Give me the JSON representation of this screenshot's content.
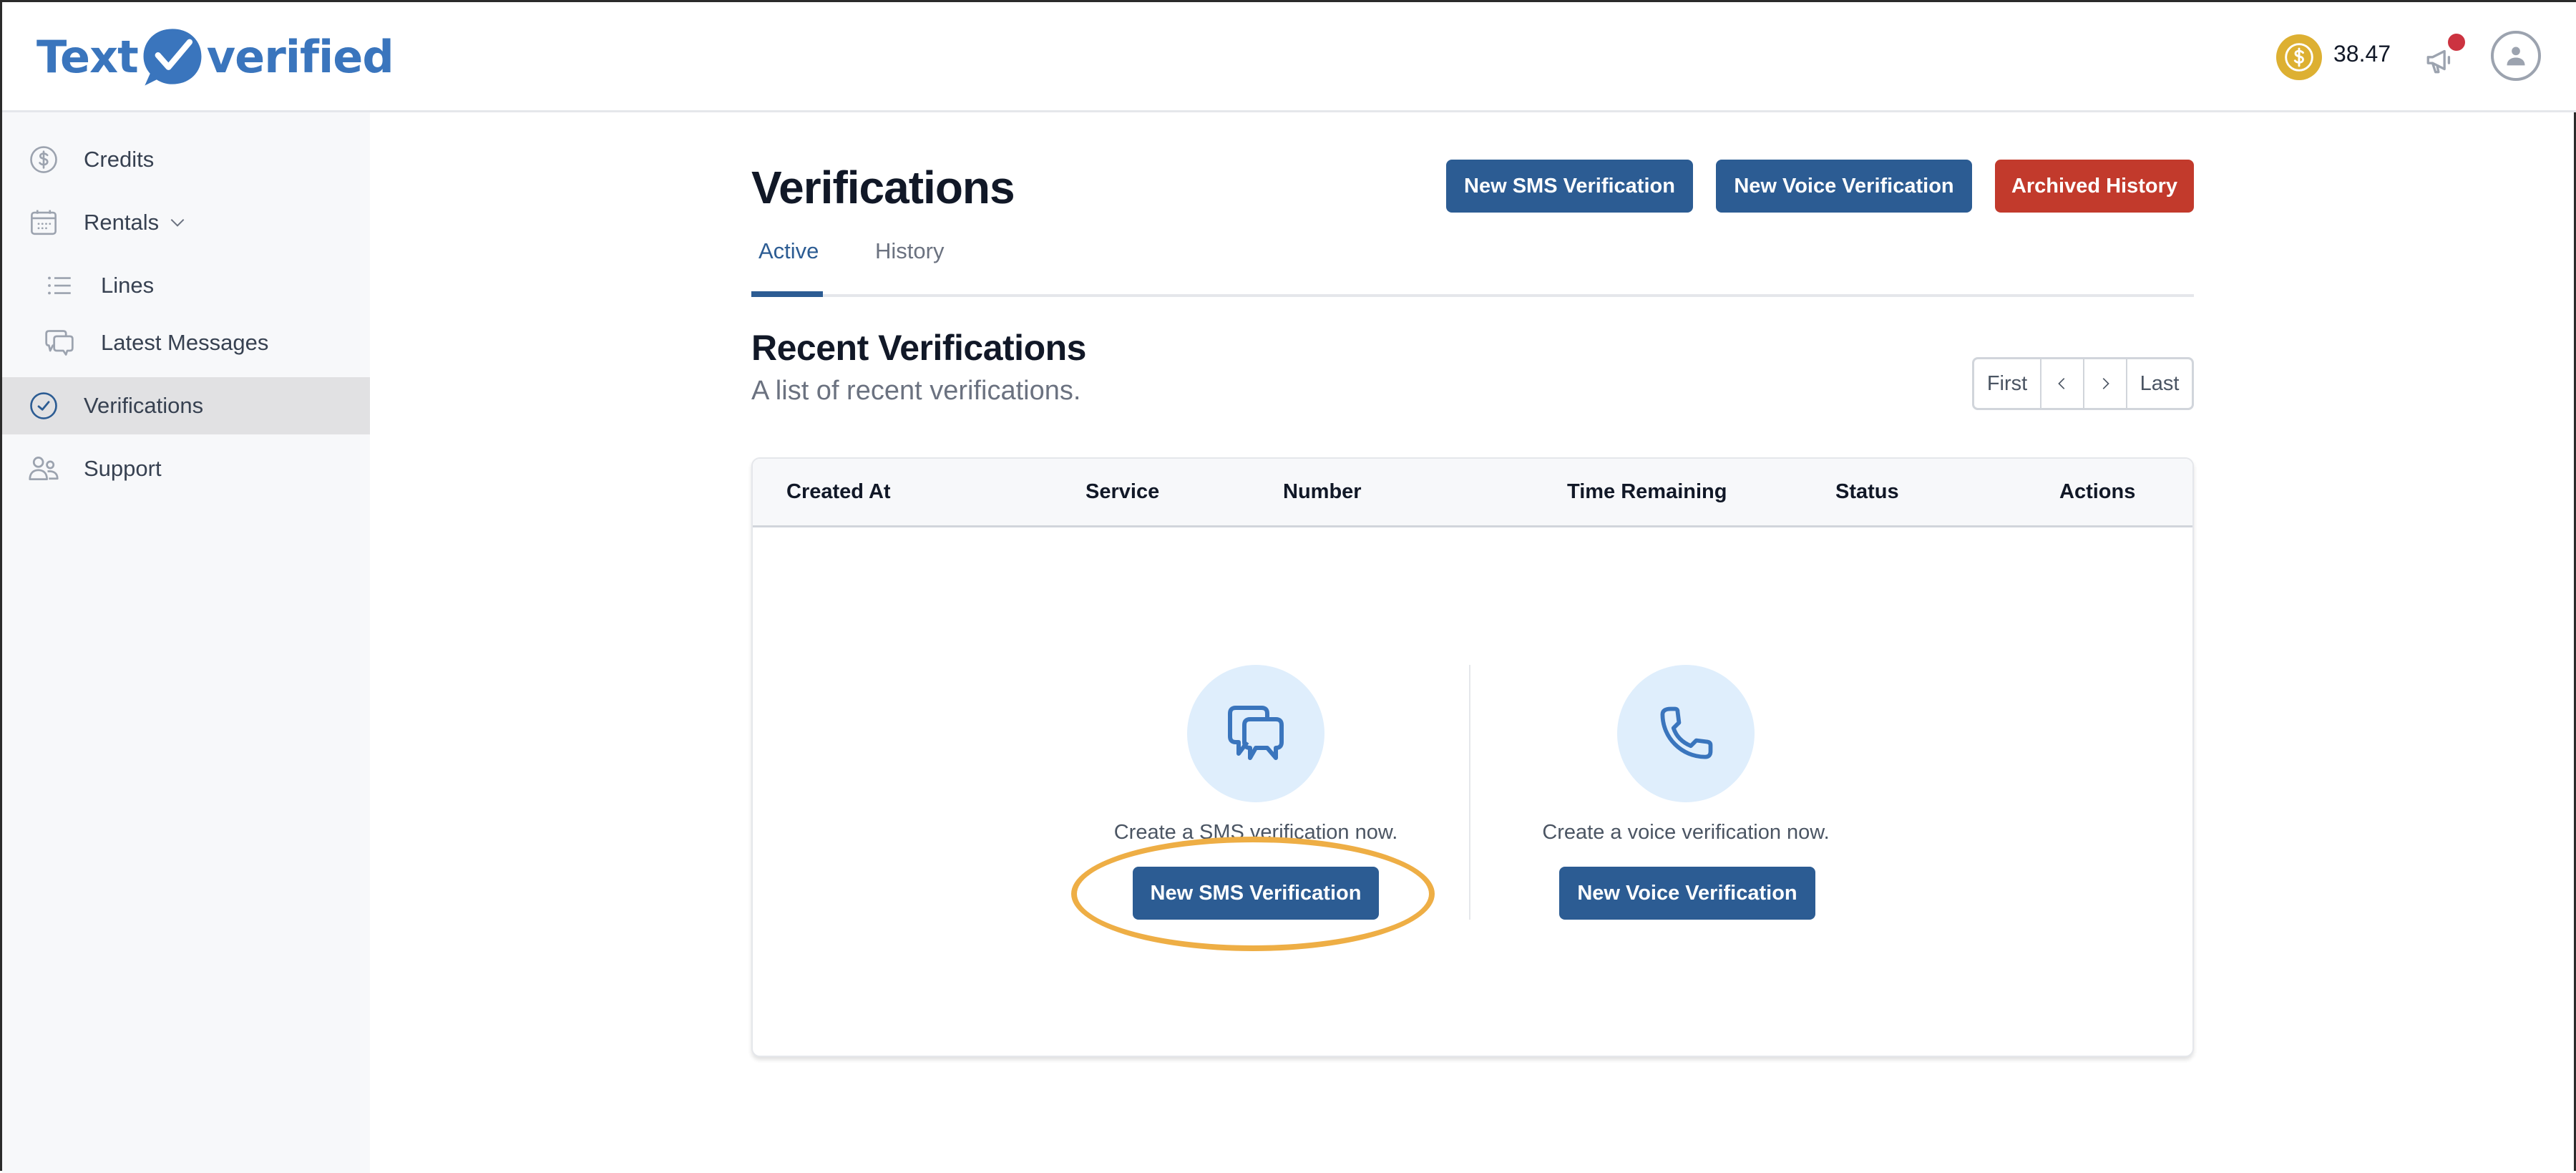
{
  "header": {
    "logo": {
      "left_text": "Text",
      "right_text": "verified",
      "icon": "chat-check-bubble-icon"
    },
    "credits": {
      "icon": "dollar-coin-icon",
      "amount": "38.47"
    },
    "announcements": {
      "icon": "megaphone-icon",
      "has_unread": true
    },
    "account": {
      "icon": "user-avatar-icon"
    }
  },
  "sidebar": {
    "items": [
      {
        "label": "Credits",
        "icon": "dollar-circle-icon"
      },
      {
        "label": "Rentals",
        "icon": "calendar-icon",
        "expanded": true
      },
      {
        "label": "Lines",
        "icon": "list-icon"
      },
      {
        "label": "Latest Messages",
        "icon": "chat-bubbles-icon"
      },
      {
        "label": "Verifications",
        "icon": "check-circle-icon",
        "active": true
      },
      {
        "label": "Support",
        "icon": "users-icon"
      }
    ]
  },
  "main": {
    "title": "Verifications",
    "actions": {
      "new_sms": "New SMS Verification",
      "new_voice": "New Voice Verification",
      "archived": "Archived History"
    },
    "tabs": [
      {
        "label": "Active",
        "active": true
      },
      {
        "label": "History",
        "active": false
      }
    ],
    "section": {
      "title": "Recent Verifications",
      "subtitle": "A list of recent verifications."
    },
    "pagination": {
      "first": "First",
      "prev": "‹",
      "next": "›",
      "last": "Last"
    },
    "table": {
      "columns": [
        "Created At",
        "Service",
        "Number",
        "Time Remaining",
        "Status",
        "Actions"
      ],
      "rows": []
    },
    "empty_state": {
      "sms": {
        "icon": "chat-bubbles-icon",
        "text": "Create a SMS verification now.",
        "button": "New SMS Verification"
      },
      "voice": {
        "icon": "phone-icon",
        "text": "Create a voice verification now.",
        "button": "New Voice Verification"
      }
    }
  },
  "colors": {
    "primary": "#2c5c93",
    "danger": "#c23a2c",
    "coin": "#ddb032",
    "logo": "#3a75bd",
    "highlight": "#eeae45",
    "notification": "#cc3340"
  }
}
